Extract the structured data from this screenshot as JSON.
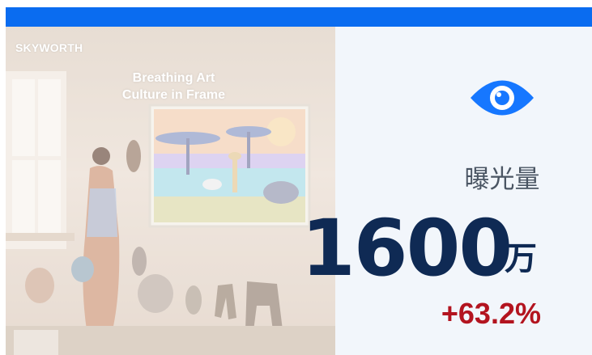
{
  "photo": {
    "brand": "SKYWORTH",
    "tagline_line1": "Breathing Art",
    "tagline_line2": "Culture in Frame"
  },
  "metric": {
    "icon": "eye-icon",
    "label": "曝光量",
    "value": "1600",
    "unit": "万",
    "change": "+63.2%"
  },
  "colors": {
    "top_bar": "#0a6cf0",
    "panel_bg": "#f2f6fb",
    "value_text": "#0f2a54",
    "change_text": "#b3141f",
    "icon": "#1677ff"
  }
}
